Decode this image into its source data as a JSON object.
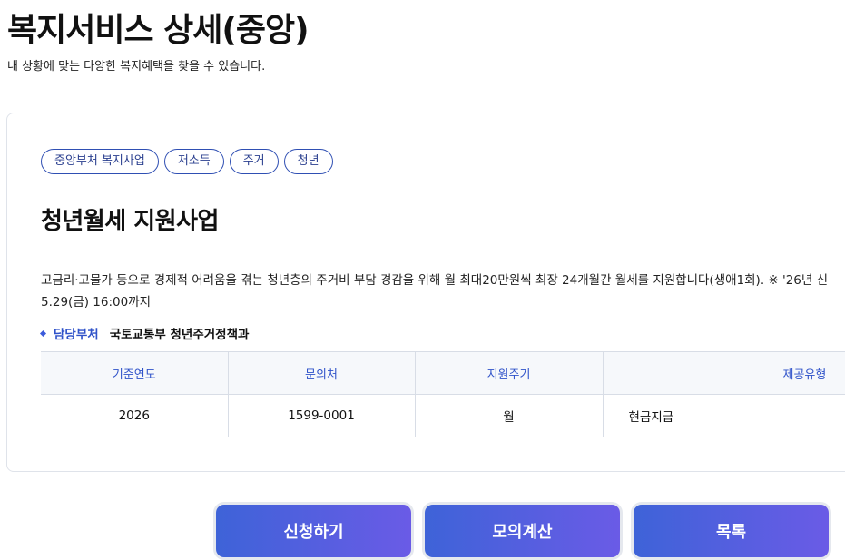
{
  "header": {
    "title": "복지서비스 상세(중앙)",
    "subtitle": "내 상황에 맞는 다양한 복지혜택을 찾을 수 있습니다."
  },
  "service": {
    "tags": [
      "중앙부처 복지사업",
      "저소득",
      "주거",
      "청년"
    ],
    "title": "청년월세 지원사업",
    "description_line1": "고금리·고물가 등으로 경제적 어려움을 겪는 청년층의 주거비 부담 경감을 위해 월 최대20만원씩 최장 24개월간 월세를 지원합니다(생애1회). ※ '26년 신",
    "description_line2": "5.29(금) 16:00까지",
    "department_label": "담당부처",
    "department_value": "국토교통부 청년주거정책과"
  },
  "table": {
    "headers": [
      "기준연도",
      "문의처",
      "지원주기",
      "제공유형"
    ],
    "row": [
      "2026",
      "1599-0001",
      "월",
      "현금지급"
    ]
  },
  "buttons": {
    "apply": "신청하기",
    "calc": "모의계산",
    "list": "목록"
  },
  "colors": {
    "accent": "#2f52c9",
    "button_gradient_start": "#3e63d8",
    "button_gradient_end": "#6a5be6"
  }
}
